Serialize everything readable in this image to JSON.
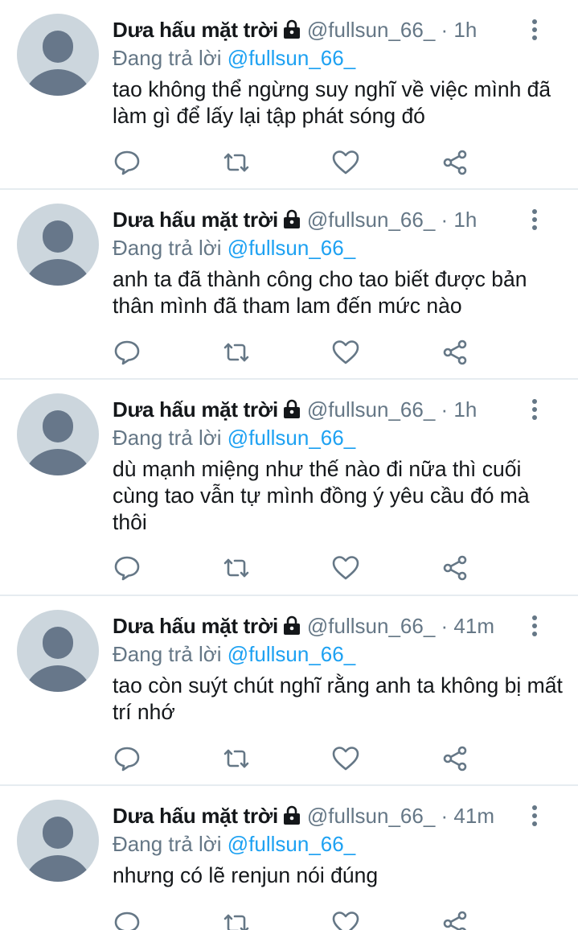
{
  "tweets": [
    {
      "name": "Dưa hấu mặt trời",
      "handle": "@fullsun_66_",
      "time": "· 1h",
      "reply_prefix": "Đang trả lời",
      "reply_to": "@fullsun_66_",
      "text": "tao không thể ngừng suy nghĩ về việc mình đã làm gì để lấy lại tập phát sóng đó"
    },
    {
      "name": "Dưa hấu mặt trời",
      "handle": "@fullsun_66_",
      "time": "· 1h",
      "reply_prefix": "Đang trả lời",
      "reply_to": "@fullsun_66_",
      "text": "anh ta đã thành công cho tao biết được bản thân mình đã tham lam đến mức nào"
    },
    {
      "name": "Dưa hấu mặt trời",
      "handle": "@fullsun_66_",
      "time": "· 1h",
      "reply_prefix": "Đang trả lời",
      "reply_to": "@fullsun_66_",
      "text": "dù mạnh miệng như thế nào đi nữa thì cuối cùng tao vẫn tự mình đồng ý yêu cầu đó mà thôi"
    },
    {
      "name": "Dưa hấu mặt trời",
      "handle": "@fullsun_66_",
      "time": "· 41m",
      "reply_prefix": "Đang trả lời",
      "reply_to": "@fullsun_66_",
      "text": "tao còn suýt chút nghĩ rằng anh ta không bị mất trí nhớ"
    },
    {
      "name": "Dưa hấu mặt trời",
      "handle": "@fullsun_66_",
      "time": "· 41m",
      "reply_prefix": "Đang trả lời",
      "reply_to": "@fullsun_66_",
      "text": "nhưng có lẽ renjun nói đúng"
    }
  ],
  "icons": {
    "lock": "lock-icon",
    "more": "more-vertical-icon",
    "reply": "reply-icon",
    "retweet": "retweet-icon",
    "like": "heart-icon",
    "share": "share-icon"
  },
  "colors": {
    "name": "#14171a",
    "secondary": "#657786",
    "mention": "#1da1f2",
    "avatar_bg": "#ccd6dd",
    "avatar_fg": "#67778a",
    "divider": "#e6ecf0"
  }
}
